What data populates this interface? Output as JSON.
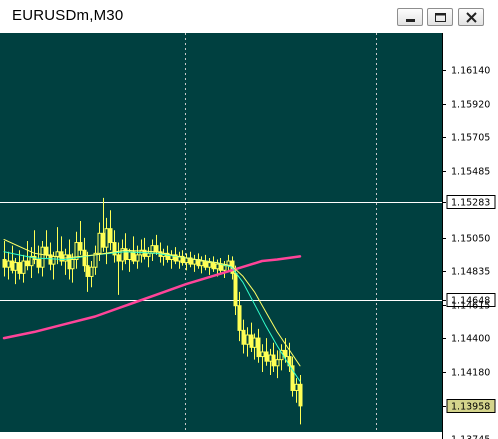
{
  "window": {
    "title": "EURUSDm,M30",
    "buttons": [
      {
        "name": "minimize-button",
        "icon": "minimize-icon"
      },
      {
        "name": "maximize-button",
        "icon": "maximize-icon"
      },
      {
        "name": "close-button",
        "icon": "close-icon"
      }
    ]
  },
  "colors": {
    "background": "#004040",
    "candles": "#ffff55",
    "ma_fast": "#ffff66",
    "ma_mid": "#33ffcc",
    "ma_slow": "#ff4499",
    "grid": "#c8c8c8",
    "level_line": "#ffffff",
    "axis_text": "#000000",
    "current_price_box": "#d4d48c"
  },
  "chart_data": {
    "type": "candlestick",
    "symbol": "EURUSDm",
    "timeframe": "M30",
    "ylim": [
      1.13745,
      1.1638
    ],
    "y_ticks": [
      "1.16140",
      "1.15920",
      "1.15705",
      "1.15485",
      "1.15283",
      "1.15050",
      "1.14835",
      "1.14648",
      "1.14615",
      "1.14400",
      "1.14180",
      "1.13958",
      "1.13745"
    ],
    "horizontal_levels": [
      {
        "price": 1.15283,
        "label": "1.15283"
      },
      {
        "price": 1.14648,
        "label": "1.14648"
      }
    ],
    "bottom_level": 1.13745,
    "current_price": {
      "price": 1.13958,
      "label": "1.13958"
    },
    "grid": "dotted vertical separators",
    "candles": [
      [
        1.1491,
        1.1503,
        1.148,
        1.1486
      ],
      [
        1.1486,
        1.1496,
        1.1478,
        1.149
      ],
      [
        1.149,
        1.15,
        1.1482,
        1.1484
      ],
      [
        1.1484,
        1.1492,
        1.1475,
        1.1489
      ],
      [
        1.1489,
        1.1497,
        1.1478,
        1.1482
      ],
      [
        1.1482,
        1.1494,
        1.1476,
        1.149
      ],
      [
        1.149,
        1.1503,
        1.1484,
        1.1487
      ],
      [
        1.1487,
        1.1499,
        1.1479,
        1.1493
      ],
      [
        1.1493,
        1.151,
        1.1488,
        1.1491
      ],
      [
        1.1491,
        1.15,
        1.1482,
        1.1486
      ],
      [
        1.1486,
        1.1503,
        1.148,
        1.1499
      ],
      [
        1.1499,
        1.151,
        1.1492,
        1.1494
      ],
      [
        1.1494,
        1.1502,
        1.1484,
        1.1488
      ],
      [
        1.1488,
        1.1496,
        1.1478,
        1.1493
      ],
      [
        1.1493,
        1.1512,
        1.1488,
        1.1496
      ],
      [
        1.1496,
        1.1506,
        1.1487,
        1.149
      ],
      [
        1.149,
        1.1498,
        1.1481,
        1.1494
      ],
      [
        1.1494,
        1.1504,
        1.1478,
        1.1485
      ],
      [
        1.1485,
        1.1495,
        1.1476,
        1.1491
      ],
      [
        1.1491,
        1.1509,
        1.1485,
        1.1502
      ],
      [
        1.1502,
        1.1516,
        1.1494,
        1.1497
      ],
      [
        1.1497,
        1.1505,
        1.1483,
        1.1487
      ],
      [
        1.1487,
        1.1496,
        1.147,
        1.148
      ],
      [
        1.148,
        1.149,
        1.1473,
        1.1486
      ],
      [
        1.1486,
        1.15,
        1.1481,
        1.1495
      ],
      [
        1.1495,
        1.1515,
        1.149,
        1.1508
      ],
      [
        1.1508,
        1.1531,
        1.1496,
        1.1499
      ],
      [
        1.1499,
        1.1518,
        1.1488,
        1.1511
      ],
      [
        1.1511,
        1.1523,
        1.1497,
        1.1502
      ],
      [
        1.1502,
        1.151,
        1.1489,
        1.1494
      ],
      [
        1.1494,
        1.1502,
        1.1468,
        1.149
      ],
      [
        1.149,
        1.1504,
        1.1484,
        1.1498
      ],
      [
        1.1498,
        1.1508,
        1.1488,
        1.1491
      ],
      [
        1.1491,
        1.1498,
        1.1483,
        1.1496
      ],
      [
        1.1496,
        1.1506,
        1.1488,
        1.149
      ],
      [
        1.149,
        1.15,
        1.1485,
        1.1494
      ],
      [
        1.1494,
        1.1504,
        1.1489,
        1.1497
      ],
      [
        1.1497,
        1.1505,
        1.1491,
        1.1493
      ],
      [
        1.1493,
        1.1499,
        1.1486,
        1.1495
      ],
      [
        1.1495,
        1.1504,
        1.149,
        1.15
      ],
      [
        1.15,
        1.1507,
        1.1494,
        1.1496
      ],
      [
        1.1496,
        1.1502,
        1.1489,
        1.1493
      ],
      [
        1.1493,
        1.1498,
        1.1487,
        1.1495
      ],
      [
        1.1495,
        1.15,
        1.1489,
        1.1491
      ],
      [
        1.1491,
        1.1497,
        1.1485,
        1.1494
      ],
      [
        1.1494,
        1.1499,
        1.1488,
        1.149
      ],
      [
        1.149,
        1.1496,
        1.1485,
        1.1493
      ],
      [
        1.1493,
        1.1497,
        1.1487,
        1.1489
      ],
      [
        1.1489,
        1.1495,
        1.1484,
        1.1492
      ],
      [
        1.1492,
        1.1496,
        1.1486,
        1.1488
      ],
      [
        1.1488,
        1.1494,
        1.1483,
        1.1491
      ],
      [
        1.1491,
        1.1495,
        1.1485,
        1.1487
      ],
      [
        1.1487,
        1.1493,
        1.1482,
        1.149
      ],
      [
        1.149,
        1.1494,
        1.1484,
        1.1486
      ],
      [
        1.1486,
        1.1492,
        1.1481,
        1.1489
      ],
      [
        1.1489,
        1.1493,
        1.1483,
        1.1485
      ],
      [
        1.1485,
        1.1491,
        1.148,
        1.1488
      ],
      [
        1.1488,
        1.1492,
        1.1482,
        1.1484
      ],
      [
        1.1484,
        1.149,
        1.1479,
        1.1487
      ],
      [
        1.1487,
        1.1494,
        1.1483,
        1.149
      ],
      [
        1.149,
        1.1493,
        1.1478,
        1.1482
      ],
      [
        1.1482,
        1.1487,
        1.1455,
        1.1461
      ],
      [
        1.1461,
        1.147,
        1.1438,
        1.1445
      ],
      [
        1.1445,
        1.1452,
        1.143,
        1.1436
      ],
      [
        1.1436,
        1.1447,
        1.1428,
        1.1442
      ],
      [
        1.1442,
        1.145,
        1.1431,
        1.1434
      ],
      [
        1.1434,
        1.1443,
        1.1426,
        1.144
      ],
      [
        1.144,
        1.1446,
        1.1424,
        1.1428
      ],
      [
        1.1428,
        1.1436,
        1.1418,
        1.1431
      ],
      [
        1.1431,
        1.144,
        1.1422,
        1.1425
      ],
      [
        1.1425,
        1.1433,
        1.1416,
        1.1429
      ],
      [
        1.1429,
        1.1437,
        1.1418,
        1.1422
      ],
      [
        1.1422,
        1.1432,
        1.1414,
        1.1426
      ],
      [
        1.1426,
        1.1436,
        1.1419,
        1.1432
      ],
      [
        1.1432,
        1.144,
        1.1424,
        1.1428
      ],
      [
        1.1428,
        1.1437,
        1.1418,
        1.1422
      ],
      [
        1.1422,
        1.1428,
        1.1402,
        1.1406
      ],
      [
        1.1406,
        1.1414,
        1.1398,
        1.141
      ],
      [
        1.141,
        1.1416,
        1.1384,
        1.1396
      ]
    ],
    "ma_fast": [
      [
        0,
        1.1504
      ],
      [
        8,
        1.1495
      ],
      [
        16,
        1.1492
      ],
      [
        24,
        1.1494
      ],
      [
        32,
        1.1497
      ],
      [
        40,
        1.1496
      ],
      [
        48,
        1.1492
      ],
      [
        56,
        1.1489
      ],
      [
        60,
        1.1487
      ],
      [
        63,
        1.148
      ],
      [
        66,
        1.147
      ],
      [
        69,
        1.1457
      ],
      [
        72,
        1.1444
      ],
      [
        75,
        1.1433
      ],
      [
        78,
        1.1422
      ]
    ],
    "ma_mid": [
      [
        0,
        1.1496
      ],
      [
        8,
        1.1492
      ],
      [
        16,
        1.1491
      ],
      [
        24,
        1.1494
      ],
      [
        32,
        1.1496
      ],
      [
        40,
        1.1495
      ],
      [
        48,
        1.1492
      ],
      [
        56,
        1.1489
      ],
      [
        60,
        1.1486
      ],
      [
        63,
        1.1476
      ],
      [
        66,
        1.1462
      ],
      [
        69,
        1.1448
      ],
      [
        72,
        1.1435
      ],
      [
        75,
        1.1423
      ],
      [
        78,
        1.1412
      ]
    ],
    "ma_slow": [
      [
        0,
        1.144
      ],
      [
        8,
        1.1444
      ],
      [
        16,
        1.1449
      ],
      [
        24,
        1.1454
      ],
      [
        32,
        1.1461
      ],
      [
        40,
        1.1468
      ],
      [
        48,
        1.1475
      ],
      [
        56,
        1.1481
      ],
      [
        60,
        1.1484
      ],
      [
        64,
        1.1487
      ],
      [
        68,
        1.149
      ],
      [
        72,
        1.1491
      ],
      [
        78,
        1.1493
      ]
    ]
  }
}
